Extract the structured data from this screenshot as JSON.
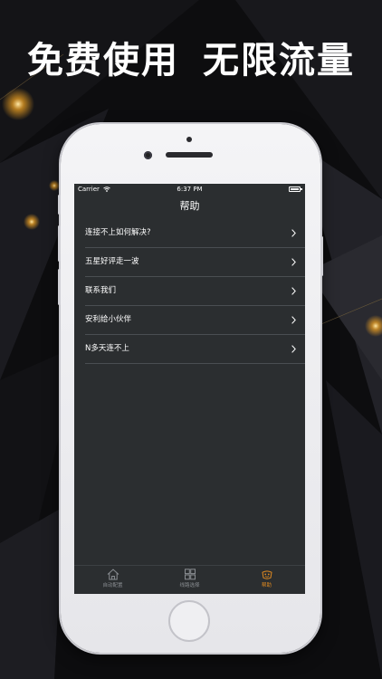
{
  "headline": {
    "left": "免费使用",
    "right": "无限流量"
  },
  "status_bar": {
    "carrier": "Carrier",
    "time": "6:37 PM"
  },
  "nav": {
    "title": "帮助"
  },
  "help_items": [
    {
      "label": "连接不上如何解决?"
    },
    {
      "label": "五星好评走一波"
    },
    {
      "label": "联系我们"
    },
    {
      "label": "安利给小伙伴"
    },
    {
      "label": "N多天连不上"
    }
  ],
  "tabs": [
    {
      "label": "自动配置",
      "icon": "home-icon",
      "active": false
    },
    {
      "label": "线路选择",
      "icon": "grid-icon",
      "active": false
    },
    {
      "label": "帮助",
      "icon": "help-icon",
      "active": true
    }
  ],
  "colors": {
    "screen_bg": "#2b2e30",
    "accent": "#e08a20",
    "text": "#ffffff"
  }
}
